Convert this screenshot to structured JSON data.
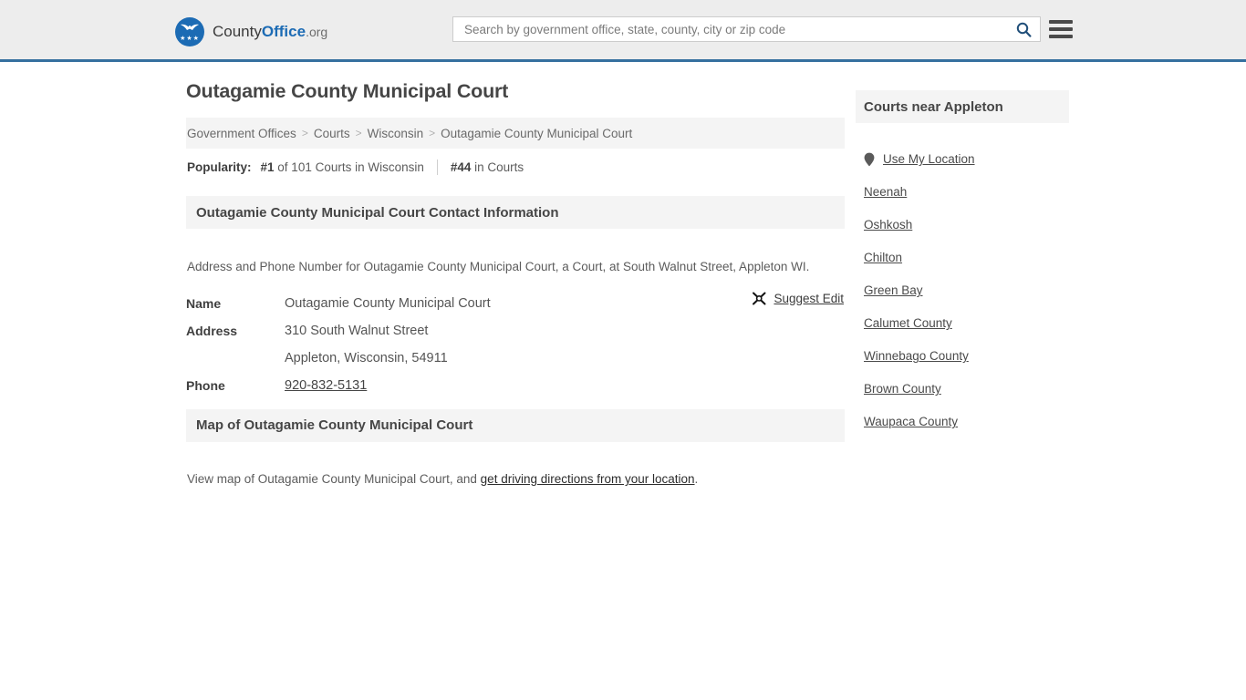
{
  "header": {
    "brand": {
      "part1": "County",
      "part2": "Office",
      "part3": ".org"
    },
    "search": {
      "placeholder": "Search by government office, state, county, city or zip code",
      "value": "",
      "icon": "search-icon"
    },
    "menu_icon": "hamburger-menu-icon"
  },
  "main": {
    "title": "Outagamie County Municipal Court",
    "breadcrumb": [
      "Government Offices",
      "Courts",
      "Wisconsin",
      "Outagamie County Municipal Court"
    ],
    "breadcrumb_separator": ">",
    "popularity": {
      "label": "Popularity:",
      "rank_state": "#1",
      "rank_state_text": " of 101 Courts in Wisconsin",
      "rank_category": "#44",
      "rank_category_text": " in Courts"
    },
    "contact": {
      "heading": "Outagamie County Municipal Court Contact Information",
      "description": "Address and Phone Number for Outagamie County Municipal Court, a Court, at South Walnut Street, Appleton WI.",
      "suggest_edit": "Suggest Edit",
      "suggest_edit_icon": "edit-pencil-icon",
      "rows": [
        {
          "label": "Name",
          "value": "Outagamie County Municipal Court",
          "link": false
        },
        {
          "label": "Address",
          "value": "310 South Walnut Street",
          "link": false
        },
        {
          "label": "",
          "value": "Appleton, Wisconsin, 54911",
          "link": false
        },
        {
          "label": "Phone",
          "value": "920-832-5131",
          "link": true
        }
      ]
    },
    "map": {
      "heading": "Map of Outagamie County Municipal Court",
      "desc_before": "View map of Outagamie County Municipal Court, and ",
      "desc_link": "get driving directions from your location",
      "desc_after": "."
    }
  },
  "sidebar": {
    "heading": "Courts near Appleton",
    "use_my_location": "Use My Location",
    "location_icon": "map-pin-icon",
    "links": [
      "Neenah",
      "Oshkosh",
      "Chilton",
      "Green Bay",
      "Calumet County",
      "Winnebago County",
      "Brown County",
      "Waupaca County"
    ]
  },
  "colors": {
    "brand_blue": "#1c6bb4",
    "header_rule": "#35709f",
    "header_bg": "#ededed",
    "panel_bg": "#f4f4f4",
    "search_icon": "#1f4e79"
  }
}
